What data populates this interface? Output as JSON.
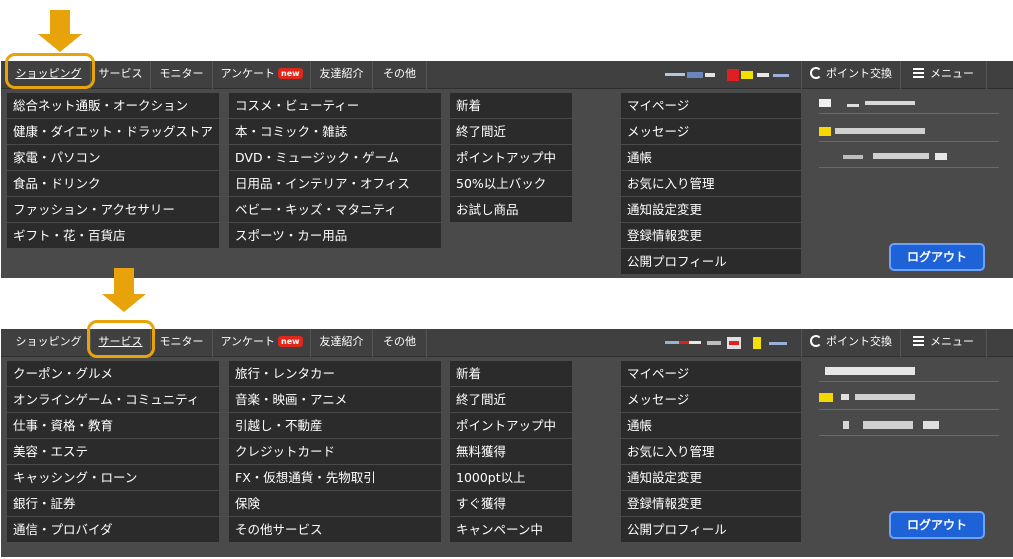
{
  "screens": [
    {
      "nav": {
        "shopping": "ショッピング",
        "service": "サービス",
        "monitor": "モニター",
        "anketo": "アンケート",
        "new_badge": "new",
        "friend": "友達紹介",
        "other": "その他",
        "point_exchange": "ポイント交換",
        "menu": "メニュー"
      },
      "col1": [
        "総合ネット通販・オークション",
        "健康・ダイエット・ドラッグストア",
        "家電・パソコン",
        "食品・ドリンク",
        "ファッション・アクセサリー",
        "ギフト・花・百貨店"
      ],
      "col2": [
        "コスメ・ビューティー",
        "本・コミック・雑誌",
        "DVD・ミュージック・ゲーム",
        "日用品・インテリア・オフィス",
        "ベビー・キッズ・マタニティ",
        "スポーツ・カー用品"
      ],
      "col3": [
        "新着",
        "終了間近",
        "ポイントアップ中",
        "50%以上バック",
        "お試し商品"
      ],
      "col4": [
        "マイページ",
        "メッセージ",
        "通帳",
        "お気に入り管理",
        "通知設定変更",
        "登録情報変更",
        "公開プロフィール"
      ],
      "logout": "ログアウト"
    },
    {
      "nav": {
        "shopping": "ショッピング",
        "service": "サービス",
        "monitor": "モニター",
        "anketo": "アンケート",
        "new_badge": "new",
        "friend": "友達紹介",
        "other": "その他",
        "point_exchange": "ポイント交換",
        "menu": "メニュー"
      },
      "col1": [
        "クーポン・グルメ",
        "オンラインゲーム・コミュニティ",
        "仕事・資格・教育",
        "美容・エステ",
        "キャッシング・ローン",
        "銀行・証券",
        "通信・プロバイダ"
      ],
      "col2": [
        "旅行・レンタカー",
        "音楽・映画・アニメ",
        "引越し・不動産",
        "クレジットカード",
        "FX・仮想通貨・先物取引",
        "保険",
        "その他サービス"
      ],
      "col3": [
        "新着",
        "終了間近",
        "ポイントアップ中",
        "無料獲得",
        "1000pt以上",
        "すぐ獲得",
        "キャンペーン中"
      ],
      "col4": [
        "マイページ",
        "メッセージ",
        "通帳",
        "お気に入り管理",
        "通知設定変更",
        "登録情報変更",
        "公開プロフィール"
      ],
      "logout": "ログアウト"
    }
  ],
  "colors": {
    "arrow": "#e8a20a",
    "panel": "#4a4a4a",
    "cell": "#2b2b2b",
    "logout": "#1e62d8",
    "new_badge": "#e0271c"
  }
}
